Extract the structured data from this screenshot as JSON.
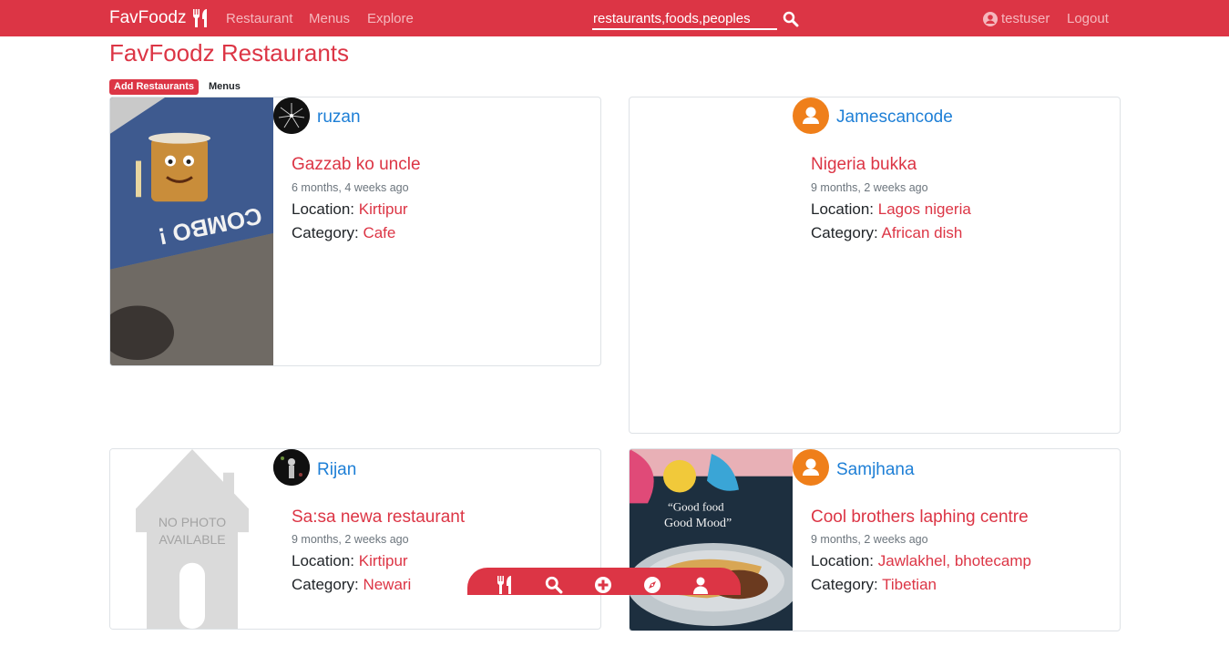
{
  "navbar": {
    "brand": "FavFoodz",
    "brand_icon": "utensils-icon",
    "links": [
      "Restaurant",
      "Menus",
      "Explore"
    ],
    "search_value": "restaurants,foods,peoples",
    "search_icon": "search-icon",
    "username": "testuser",
    "logout": "Logout"
  },
  "header": {
    "title": "FavFoodz Restaurants",
    "add_button": "Add Restaurants",
    "menus_link": "Menus"
  },
  "labels": {
    "location": "Location:",
    "category": "Category:"
  },
  "restaurants": [
    {
      "username": "ruzan",
      "name": "Gazzab ko uncle",
      "time": "6 months, 4 weeks ago",
      "location": "Kirtipur",
      "category": "Cafe"
    },
    {
      "username": "Jamescancode",
      "name": "Nigeria bukka",
      "time": "9 months, 2 weeks ago",
      "location": "Lagos nigeria",
      "category": "African dish"
    },
    {
      "username": "Rijan",
      "name": "Sa:sa newa restaurant",
      "time": "9 months, 2 weeks ago",
      "location": "Kirtipur",
      "category": "Newari",
      "placeholder_text": [
        "NO PHOTO",
        "AVAILABLE"
      ]
    },
    {
      "username": "Samjhana",
      "name": "Cool brothers laphing centre",
      "time": "9 months, 2 weeks ago",
      "location": "Jawlakhel, bhotecamp",
      "category": "Tibetian",
      "photo_text": [
        "“Good food",
        "Good Mood”"
      ]
    }
  ],
  "bottom_bar": {
    "icons": [
      "utensils-icon",
      "search-icon",
      "plus-circle-icon",
      "compass-icon",
      "user-icon"
    ]
  },
  "colors": {
    "primary": "#dc3545",
    "link": "#1e7fd6",
    "muted": "#6c757d",
    "avatar_orange": "#ef7f1a"
  }
}
